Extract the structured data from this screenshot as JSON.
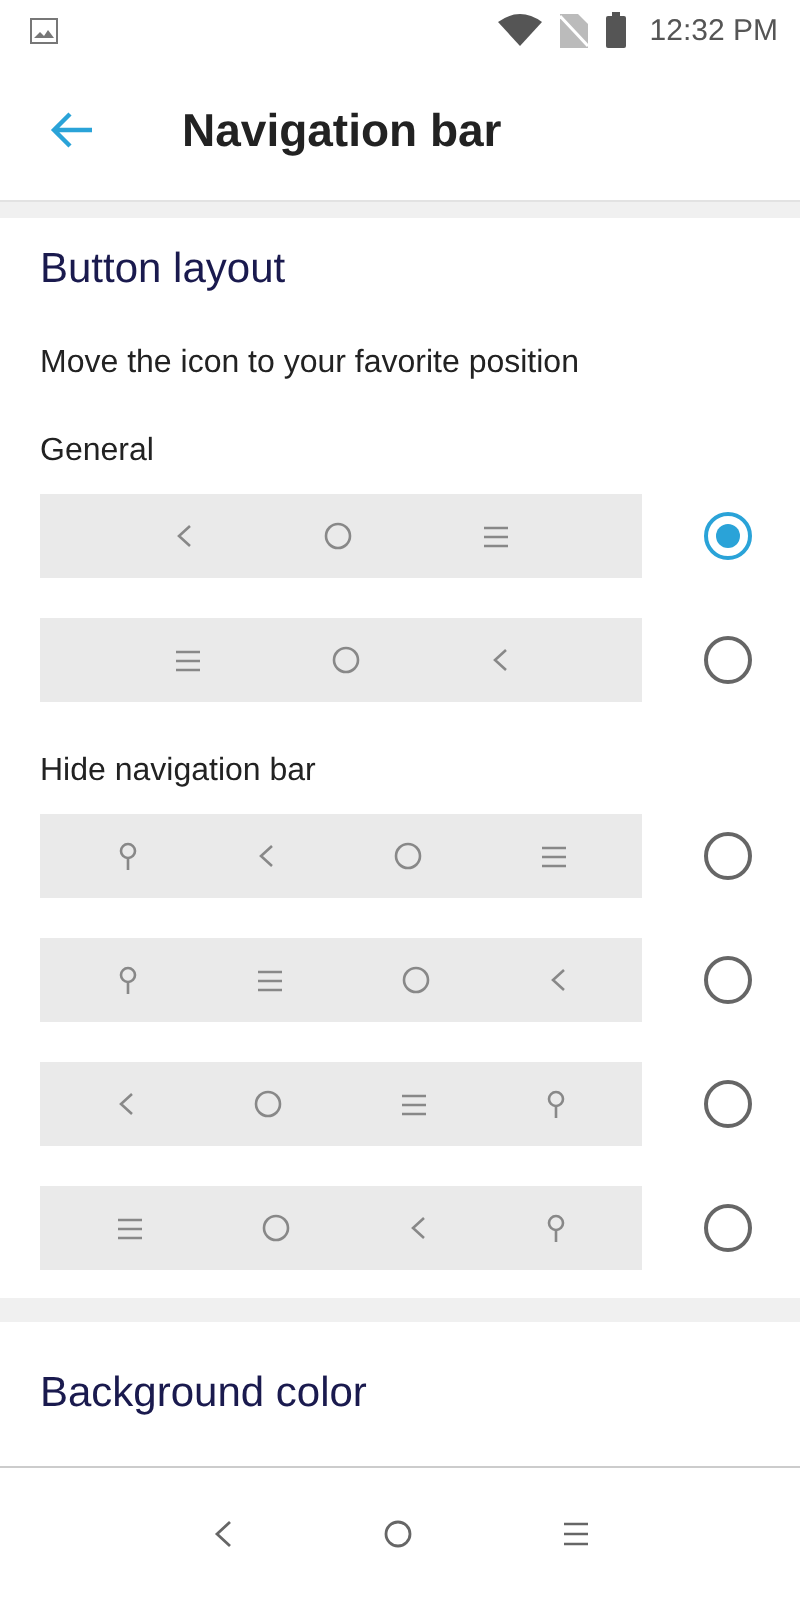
{
  "status_bar": {
    "time": "12:32 PM"
  },
  "toolbar": {
    "title": "Navigation bar"
  },
  "section": {
    "title": "Button layout",
    "subtitle": "Move the icon to your favorite position",
    "groups": [
      {
        "label": "General",
        "options": [
          {
            "selected": true,
            "icons": [
              {
                "kind": "back"
              },
              {
                "kind": "home"
              },
              {
                "kind": "recents"
              }
            ]
          },
          {
            "selected": false,
            "icons": [
              {
                "kind": "recents"
              },
              {
                "kind": "home"
              },
              {
                "kind": "back"
              }
            ]
          }
        ]
      },
      {
        "label": "Hide navigation bar",
        "options": [
          {
            "selected": false,
            "icons": [
              {
                "kind": "pin"
              },
              {
                "kind": "back"
              },
              {
                "kind": "home"
              },
              {
                "kind": "recents"
              }
            ]
          },
          {
            "selected": false,
            "icons": [
              {
                "kind": "pin"
              },
              {
                "kind": "recents"
              },
              {
                "kind": "home"
              },
              {
                "kind": "back"
              }
            ]
          },
          {
            "selected": false,
            "icons": [
              {
                "kind": "back"
              },
              {
                "kind": "home"
              },
              {
                "kind": "recents"
              },
              {
                "kind": "pin"
              }
            ]
          },
          {
            "selected": false,
            "icons": [
              {
                "kind": "recents"
              },
              {
                "kind": "home"
              },
              {
                "kind": "back"
              },
              {
                "kind": "pin"
              }
            ]
          }
        ]
      }
    ]
  },
  "next_section": {
    "title": "Background color"
  },
  "nav_bar": {
    "icons": [
      {
        "kind": "back"
      },
      {
        "kind": "home"
      },
      {
        "kind": "recents"
      }
    ]
  }
}
